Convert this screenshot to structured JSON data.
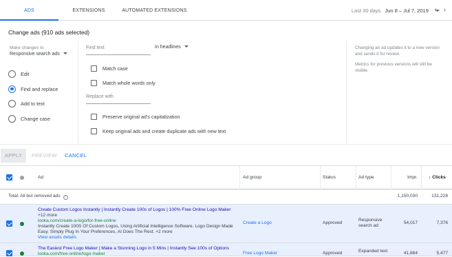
{
  "tabs": [
    {
      "label": "ADS",
      "active": true
    },
    {
      "label": "EXTENSIONS",
      "active": false
    },
    {
      "label": "AUTOMATED EXTENSIONS",
      "active": false
    }
  ],
  "date_range": {
    "label": "Last 30 days",
    "value": "Jun 8 – Jul 7, 2019"
  },
  "panel": {
    "title": "Change ads (910 ads selected)",
    "make_changes_label": "Make changes to",
    "make_changes_value": "Responsive search ads",
    "radio_options": [
      {
        "label": "Edit",
        "selected": false
      },
      {
        "label": "Find and replace",
        "selected": true
      },
      {
        "label": "Add to text",
        "selected": false
      },
      {
        "label": "Change case",
        "selected": false
      }
    ],
    "find_text_placeholder": "Find text",
    "in_field": "In headlines",
    "match_case": "Match case",
    "match_whole_words": "Match whole words only",
    "replace_with_placeholder": "Replace with",
    "preserve_capitalization": "Preserve original ad's capitalization",
    "keep_original": "Keep original ads and create duplicate ads with new text",
    "note_1": "Changing an ad updates it to a new version and sends it for review.",
    "note_2": "Metrics for previous versions will still be visible."
  },
  "actions": {
    "apply": "APPLY",
    "preview": "PREVIEW",
    "cancel": "CANCEL"
  },
  "table": {
    "headers": {
      "ad": "Ad",
      "ad_group": "Ad group",
      "status": "Status",
      "ad_type": "Ad type",
      "impr": "Impr.",
      "clicks": "Clicks",
      "sort_arrow": "↓"
    },
    "total": {
      "label": "Total: All but removed ads",
      "help": "?",
      "impr": "1,150,030",
      "clicks": "131,228"
    },
    "rows": [
      {
        "headline": "Create Custom Logos Instantly | Instantly Create 100s of Logos | 100% Free Online Logo Maker",
        "more": "+12 more",
        "url": "looka.com/create-a-logo/for-free-online",
        "description": "Instantly Create 100S Of Custom Logos, Using Artificial Intelligence Software. Logo Design Made Easy. Simply Plug In Your Preferences, AI Does The Rest.",
        "desc_more": "+2 more",
        "view_assets": "View assets details",
        "ad_group": "Create a Logo",
        "status": "Approved",
        "ad_type": "Responsive search ad",
        "impr": "54,017",
        "clicks": "7,376"
      },
      {
        "headline": "The Easiest Free Logo Maker | Make a Stunning Logo in 5 Mins | Instantly See 100s of Options",
        "url": "looka.com/free-online/logo-maker",
        "ad_group": "Free Logo Maker",
        "status": "Approved",
        "ad_type": "Expanded text",
        "impr": "41,884",
        "clicks": "5,477"
      }
    ]
  },
  "colors": {
    "accent": "#1a73e8",
    "row_selected": "#e8f0fe",
    "status_dot": "#188038",
    "link": "#1a0dab",
    "url": "#188038"
  }
}
